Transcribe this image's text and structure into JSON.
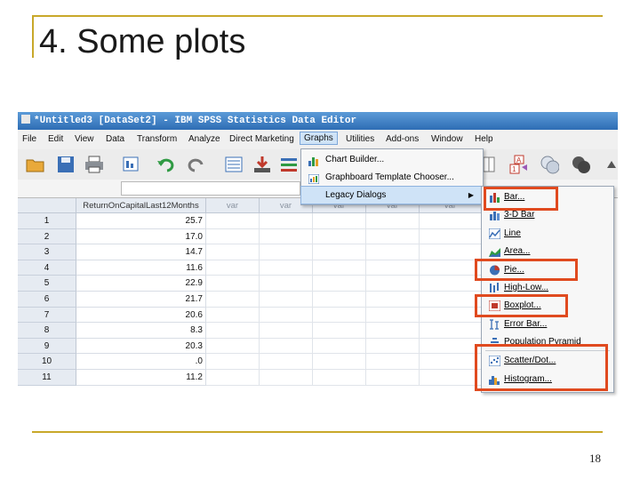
{
  "slide": {
    "title": "4. Some plots",
    "page_number": "18"
  },
  "window": {
    "title": "*Untitled3 [DataSet2] - IBM SPSS Statistics Data Editor"
  },
  "menubar": [
    "File",
    "Edit",
    "View",
    "Data",
    "Transform",
    "Analyze",
    "Direct Marketing",
    "Graphs",
    "Utilities",
    "Add-ons",
    "Window",
    "Help"
  ],
  "graphs_menu": {
    "items": [
      "Chart Builder...",
      "Graphboard Template Chooser...",
      "Legacy Dialogs"
    ]
  },
  "legacy_menu": {
    "items": [
      "Bar...",
      "3-D Bar",
      "Line",
      "Area...",
      "Pie...",
      "High-Low...",
      "Boxplot...",
      "Error Bar...",
      "Population Pyramid",
      "Scatter/Dot...",
      "Histogram..."
    ]
  },
  "grid": {
    "columns": [
      "ReturnOnCapitalLast12Months",
      "var",
      "var",
      "var",
      "var",
      "var"
    ],
    "rows": [
      {
        "n": "1",
        "v": "25.7"
      },
      {
        "n": "2",
        "v": "17.0"
      },
      {
        "n": "3",
        "v": "14.7"
      },
      {
        "n": "4",
        "v": "11.6"
      },
      {
        "n": "5",
        "v": "22.9"
      },
      {
        "n": "6",
        "v": "21.7"
      },
      {
        "n": "7",
        "v": "20.6"
      },
      {
        "n": "8",
        "v": "8.3"
      },
      {
        "n": "9",
        "v": "20.3"
      },
      {
        "n": "10",
        "v": ".0"
      },
      {
        "n": "11",
        "v": "11.2"
      }
    ]
  },
  "colors": {
    "accent_line": "#c8a82a",
    "highlight_box": "#e04a1f",
    "titlebar": "#2e6db4"
  }
}
